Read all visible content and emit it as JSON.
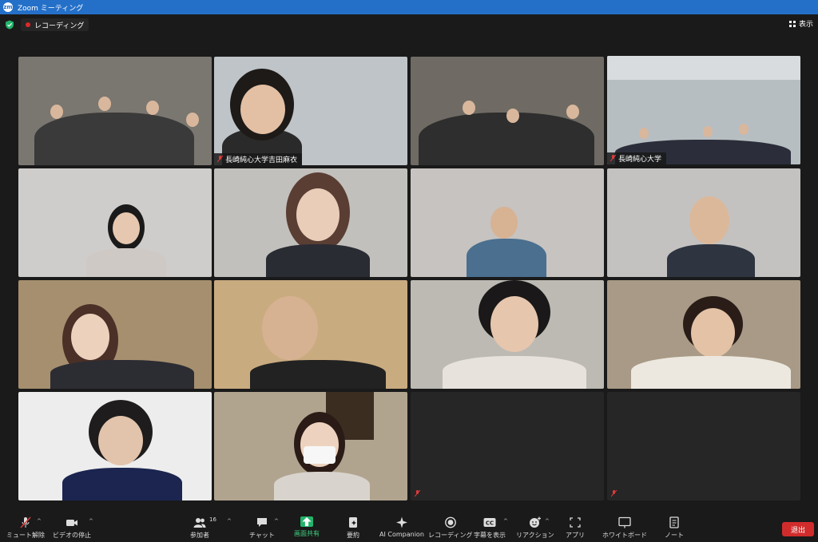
{
  "window": {
    "title": "Zoom ミーティング",
    "logo": "zm"
  },
  "header": {
    "recording_label": "レコーディング",
    "view_label": "表示"
  },
  "tiles": [
    {
      "name": "",
      "bg": "#7a7670"
    },
    {
      "name": "長崎純心大学吉田麻衣",
      "bg": "#bfc4c8"
    },
    {
      "name": "",
      "bg": "#6f6b64"
    },
    {
      "name": "長崎純心大学",
      "bg": "#b7bec2"
    },
    {
      "name": "",
      "bg": "#cfcdcb"
    },
    {
      "name": "",
      "bg": "#c2c0bc"
    },
    {
      "name": "",
      "bg": "#c6c3c0"
    },
    {
      "name": "",
      "bg": "#c3c2c0"
    },
    {
      "name": "",
      "bg": "#a58f6e"
    },
    {
      "name": "",
      "bg": "#c9ab80"
    },
    {
      "name": "",
      "bg": "#bdbab4"
    },
    {
      "name": "",
      "bg": "#a89a86"
    },
    {
      "name": "",
      "bg": "#ededed"
    },
    {
      "name": "",
      "bg": "#b1a48f"
    },
    {
      "name": "",
      "bg": "#262626"
    },
    {
      "name": "",
      "bg": "#262626"
    }
  ],
  "toolbar": {
    "mute": "ミュート解除",
    "video": "ビデオの停止",
    "participants": "参加者",
    "participants_count": "16",
    "chat": "チャット",
    "share": "画面共有",
    "summary": "要約",
    "ai": "AI Companion",
    "record": "レコーディング",
    "captions": "字幕を表示",
    "captions_icon": "CC",
    "reactions": "リアクション",
    "apps": "アプリ",
    "whiteboard": "ホワイトボード",
    "notes": "ノート",
    "leave": "退出"
  },
  "colors": {
    "accent": "#2470c9",
    "active_speaker": "#c6e05a",
    "share": "#22b36b",
    "leave": "#d12c2c"
  }
}
